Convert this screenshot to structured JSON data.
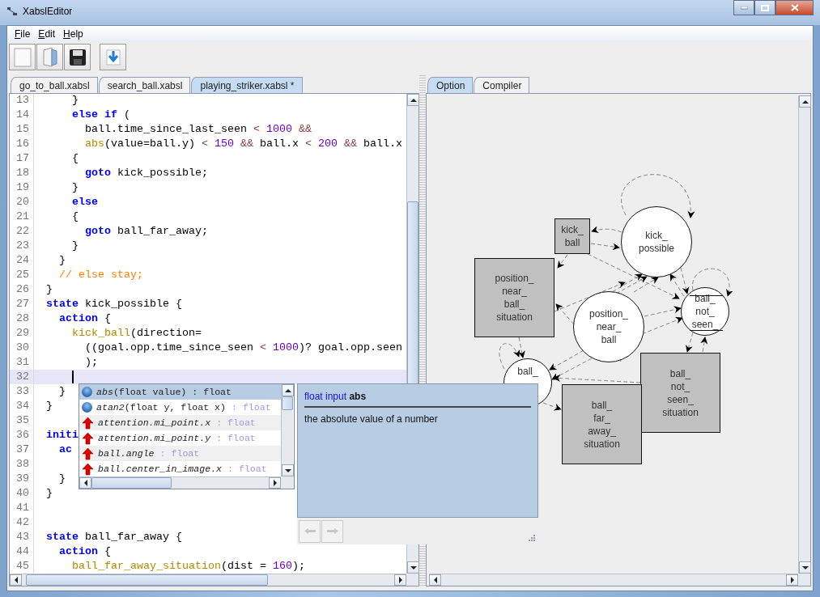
{
  "window": {
    "title": "XabslEditor"
  },
  "menu": [
    {
      "label": "File"
    },
    {
      "label": "Edit"
    },
    {
      "label": "Help"
    }
  ],
  "toolbar": [
    {
      "kind": "new"
    },
    {
      "kind": "open"
    },
    {
      "kind": "save"
    },
    {
      "kind": "export"
    }
  ],
  "editor_tabs": [
    {
      "label": "go_to_ball.xabsl",
      "selected": false
    },
    {
      "label": "search_ball.xabsl",
      "selected": false
    },
    {
      "label": "playing_striker.xabsl *",
      "selected": true
    }
  ],
  "code": {
    "lines": [
      {
        "number": "13",
        "current": false,
        "tokens": [
          {
            "t": "    }",
            "kind": "tx"
          }
        ]
      },
      {
        "number": "14",
        "current": false,
        "tokens": [
          {
            "t": "    else if",
            "kind": "kw"
          },
          {
            "t": " (",
            "kind": "tx"
          }
        ]
      },
      {
        "number": "15",
        "current": false,
        "tokens": [
          {
            "t": "      ball.time_since_last_seen ",
            "kind": "tx"
          },
          {
            "t": "<",
            "kind": "op"
          },
          {
            "t": " 1000",
            "kind": "num"
          },
          {
            "t": " &&",
            "kind": "op"
          }
        ]
      },
      {
        "number": "16",
        "current": false,
        "tokens": [
          {
            "t": "      abs",
            "kind": "fn"
          },
          {
            "t": "(value=ball.y) ",
            "kind": "tx"
          },
          {
            "t": "<",
            "kind": "op"
          },
          {
            "t": " 150",
            "kind": "num"
          },
          {
            "t": " &&",
            "kind": "op"
          },
          {
            "t": " ball.x ",
            "kind": "tx"
          },
          {
            "t": "<",
            "kind": "op"
          },
          {
            "t": " 200",
            "kind": "num"
          },
          {
            "t": " &&",
            "kind": "op"
          },
          {
            "t": " ball.x",
            "kind": "tx"
          }
        ]
      },
      {
        "number": "17",
        "current": false,
        "tokens": [
          {
            "t": "    {",
            "kind": "tx"
          }
        ]
      },
      {
        "number": "18",
        "current": false,
        "tokens": [
          {
            "t": "      goto",
            "kind": "kw"
          },
          {
            "t": " kick_possible;",
            "kind": "tx"
          }
        ]
      },
      {
        "number": "19",
        "current": false,
        "tokens": [
          {
            "t": "    }",
            "kind": "tx"
          }
        ]
      },
      {
        "number": "20",
        "current": false,
        "tokens": [
          {
            "t": "    else",
            "kind": "kw"
          }
        ]
      },
      {
        "number": "21",
        "current": false,
        "tokens": [
          {
            "t": "    {",
            "kind": "tx"
          }
        ]
      },
      {
        "number": "22",
        "current": false,
        "tokens": [
          {
            "t": "      goto",
            "kind": "kw"
          },
          {
            "t": " ball_far_away;",
            "kind": "tx"
          }
        ]
      },
      {
        "number": "23",
        "current": false,
        "tokens": [
          {
            "t": "    }",
            "kind": "tx"
          }
        ]
      },
      {
        "number": "24",
        "current": false,
        "tokens": [
          {
            "t": "  }",
            "kind": "tx"
          }
        ]
      },
      {
        "number": "25",
        "current": false,
        "tokens": [
          {
            "t": "  // else stay;",
            "kind": "cm"
          }
        ]
      },
      {
        "number": "26",
        "current": false,
        "tokens": [
          {
            "t": "}",
            "kind": "tx"
          }
        ]
      },
      {
        "number": "27",
        "current": false,
        "tokens": [
          {
            "t": "state",
            "kind": "kw"
          },
          {
            "t": " kick_possible {",
            "kind": "tx"
          }
        ]
      },
      {
        "number": "28",
        "current": false,
        "tokens": [
          {
            "t": "  action",
            "kind": "kw"
          },
          {
            "t": " {",
            "kind": "tx"
          }
        ]
      },
      {
        "number": "29",
        "current": false,
        "tokens": [
          {
            "t": "    kick_ball",
            "kind": "fn"
          },
          {
            "t": "(direction=",
            "kind": "tx"
          }
        ]
      },
      {
        "number": "30",
        "current": false,
        "tokens": [
          {
            "t": "      ((goal.opp.time_since_seen ",
            "kind": "tx"
          },
          {
            "t": "<",
            "kind": "op"
          },
          {
            "t": " 1000",
            "kind": "num"
          },
          {
            "t": ")? goal.opp.seen",
            "kind": "tx"
          }
        ]
      },
      {
        "number": "31",
        "current": false,
        "tokens": [
          {
            "t": "      );",
            "kind": "tx"
          }
        ]
      },
      {
        "number": "32",
        "current": true
      },
      {
        "number": "33",
        "current": false,
        "tokens": [
          {
            "t": "  }",
            "kind": "tx"
          }
        ]
      },
      {
        "number": "34",
        "current": false,
        "tokens": [
          {
            "t": "}",
            "kind": "tx"
          }
        ]
      },
      {
        "number": "35",
        "current": false
      },
      {
        "number": "36",
        "current": false,
        "tokens": [
          {
            "t": "initi",
            "kind": "kw"
          }
        ]
      },
      {
        "number": "37",
        "current": false,
        "tokens": [
          {
            "t": "  ac",
            "kind": "kw"
          }
        ]
      },
      {
        "number": "38",
        "current": false
      },
      {
        "number": "39",
        "current": false,
        "tokens": [
          {
            "t": "  }",
            "kind": "tx"
          }
        ]
      },
      {
        "number": "40",
        "current": false,
        "tokens": [
          {
            "t": "}",
            "kind": "tx"
          }
        ]
      },
      {
        "number": "41",
        "current": false
      },
      {
        "number": "42",
        "current": false
      },
      {
        "number": "43",
        "current": false,
        "tokens": [
          {
            "t": "state",
            "kind": "kw"
          },
          {
            "t": " ball_far_away {",
            "kind": "tx"
          }
        ]
      },
      {
        "number": "44",
        "current": false,
        "tokens": [
          {
            "t": "  action",
            "kind": "kw"
          },
          {
            "t": " {",
            "kind": "tx"
          }
        ]
      },
      {
        "number": "45",
        "current": false,
        "tokens": [
          {
            "t": "    ball_far_away_situation",
            "kind": "fn"
          },
          {
            "t": "(dist = ",
            "kind": "tx"
          },
          {
            "t": "160",
            "kind": "num"
          },
          {
            "t": ");",
            "kind": "tx"
          }
        ]
      }
    ]
  },
  "completion": {
    "items": [
      {
        "kind": "method",
        "name": "abs",
        "params": "(float value)",
        "type": ": float",
        "selected": true
      },
      {
        "kind": "method",
        "name": "atan2",
        "params": "(float y, float x)",
        "type": ": float",
        "selected": false
      },
      {
        "kind": "input",
        "name": "attention.mi_point.x",
        "type": ": float",
        "selected": false
      },
      {
        "kind": "input",
        "name": "attention.mi_point.y",
        "type": ": float",
        "selected": false
      },
      {
        "kind": "input",
        "name": "ball.angle",
        "type": ": float",
        "selected": false
      },
      {
        "kind": "input",
        "name": "ball.center_in_image.x",
        "type": ": float",
        "selected": false
      }
    ]
  },
  "doc_popup": {
    "title": "float input **abs**",
    "text": "the absolute value of a number",
    "back_disabled": true,
    "forward_disabled": true
  },
  "view_tabs": [
    {
      "label": "Option",
      "selected": true
    },
    {
      "label": "Compiler",
      "selected": false
    }
  ],
  "diagram": {
    "nodes": [
      {
        "kind": "option",
        "label": "kick_ ball"
      },
      {
        "kind": "state",
        "label": "kick_ possible"
      },
      {
        "kind": "option",
        "label": "position_ near_ ball_ situation"
      },
      {
        "kind": "state",
        "label": "position_ near_ ball"
      },
      {
        "kind": "initial_state",
        "label": "ball_ not_ seen_"
      },
      {
        "kind": "state",
        "label": "ball_"
      },
      {
        "kind": "option",
        "label": "ball_ not_ seen_ situation"
      },
      {
        "kind": "option",
        "label": "ball_ far_ away_ situation"
      }
    ]
  }
}
